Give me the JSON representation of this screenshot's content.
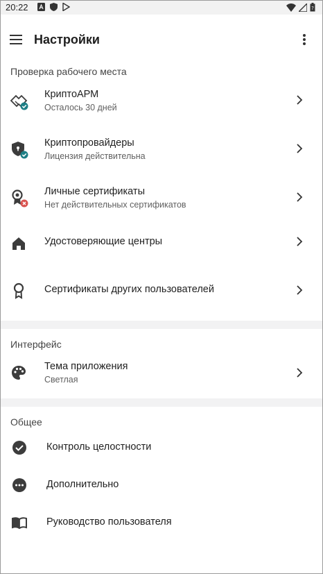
{
  "status_bar": {
    "time": "20:22"
  },
  "app_bar": {
    "title": "Настройки"
  },
  "sections": {
    "workplace": {
      "header": "Проверка рабочего места",
      "items": [
        {
          "title": "КриптоАРМ",
          "subtitle": "Осталось 30 дней",
          "icon": "handshake-icon",
          "badge": "ok"
        },
        {
          "title": "Криптопровайдеры",
          "subtitle": "Лицензия действительна",
          "icon": "shield-lock-icon",
          "badge": "ok"
        },
        {
          "title": "Личные сертификаты",
          "subtitle": "Нет действительных сертификатов",
          "icon": "certificate-icon",
          "badge": "error"
        },
        {
          "title": "Удостоверяющие центры",
          "icon": "home-icon"
        },
        {
          "title": "Сертификаты других пользователей",
          "icon": "award-icon"
        }
      ]
    },
    "interface": {
      "header": "Интерфейс",
      "items": [
        {
          "title": "Тема приложения",
          "subtitle": "Светлая",
          "icon": "palette-icon"
        }
      ]
    },
    "general": {
      "header": "Общее",
      "items": [
        {
          "title": "Контроль целостности",
          "icon": "check-circle-icon"
        },
        {
          "title": "Дополнительно",
          "icon": "more-circle-icon"
        },
        {
          "title": "Руководство пользователя",
          "icon": "book-icon"
        }
      ]
    }
  },
  "colors": {
    "ok_badge": "#1e7f86",
    "error_badge": "#d9534f",
    "icon": "#3c3c3c",
    "divider": "#f2f2f3"
  }
}
